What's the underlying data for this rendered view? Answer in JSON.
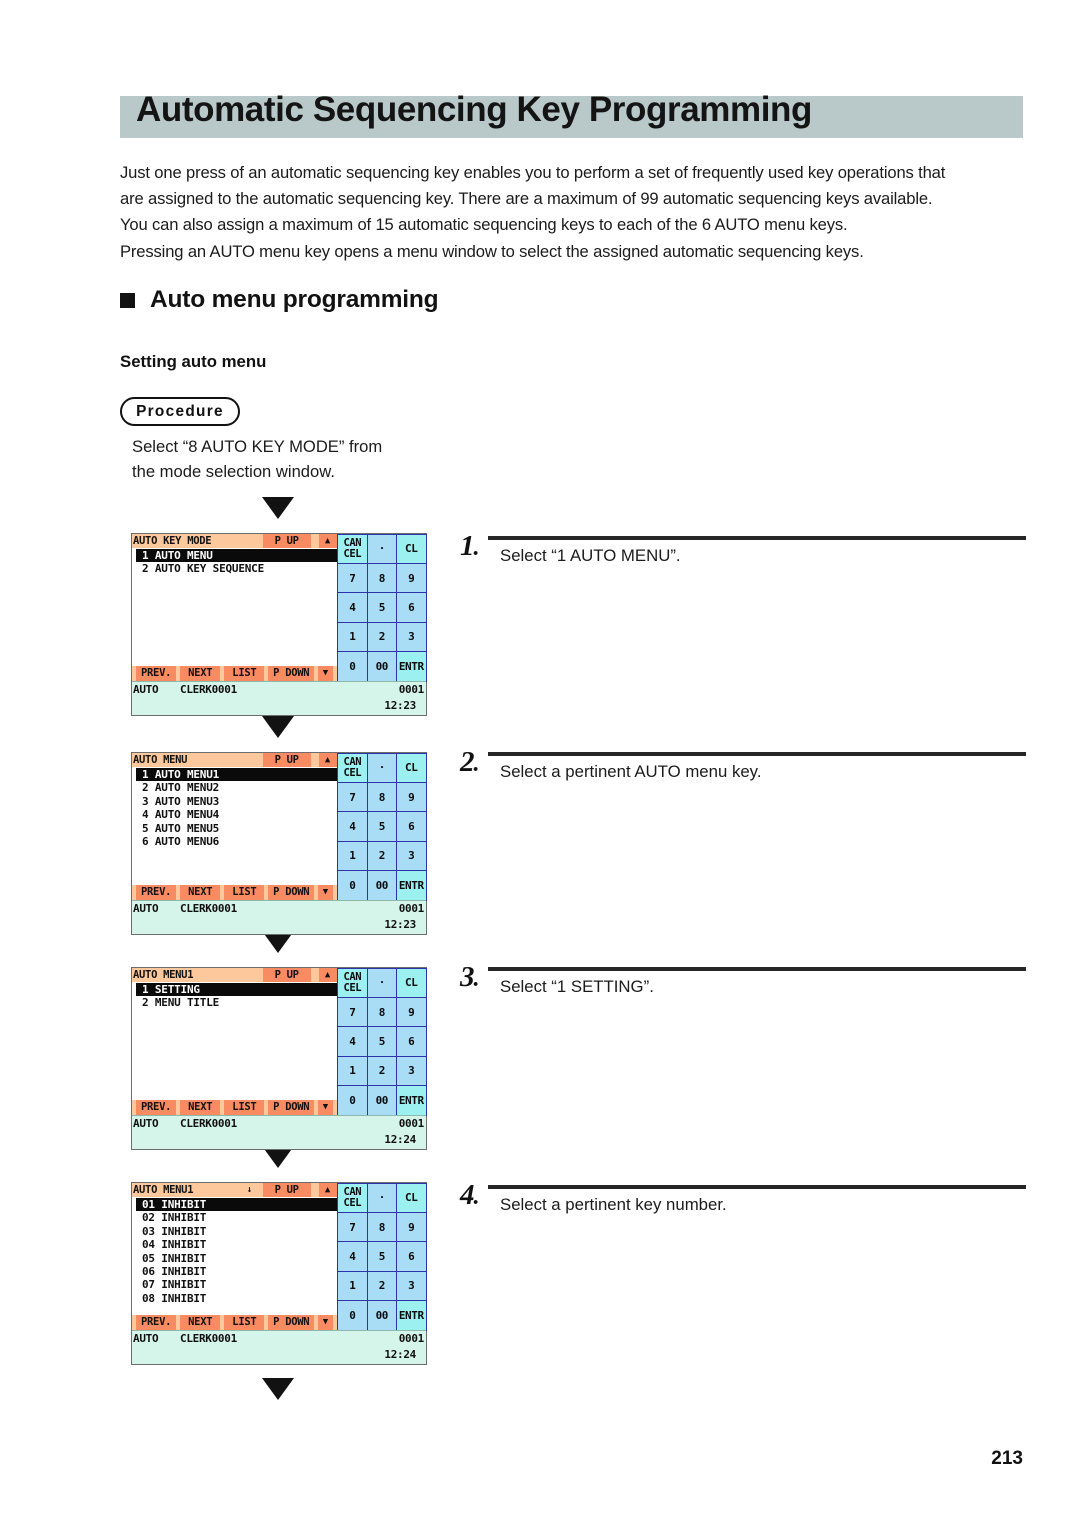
{
  "page": {
    "title": "Automatic Sequencing Key Programming",
    "page_number": "213",
    "banner_color": "#b9c8c9"
  },
  "intro": {
    "line1": "Just one press of an automatic sequencing key enables you to perform a set of frequently used key operations that",
    "line2": "are assigned to the automatic sequencing key. There are a maximum of 99 automatic sequencing keys available.",
    "line3": "You can also assign a maximum of 15 automatic sequencing keys to each of the 6 AUTO menu keys.",
    "line4": "Pressing an AUTO menu key opens a menu window to select the assigned automatic sequencing keys."
  },
  "section": {
    "heading": "Auto menu programming",
    "subheading": "Setting auto menu",
    "procedure_label": "Procedure",
    "procedure_intro_line1": "Select “8 AUTO KEY MODE” from",
    "procedure_intro_line2": "the mode selection window."
  },
  "steps": [
    {
      "number": "1",
      "dot": ".",
      "text": "Select “1 AUTO MENU”."
    },
    {
      "number": "2",
      "dot": ".",
      "text": "Select a pertinent AUTO menu key."
    },
    {
      "number": "3",
      "dot": ".",
      "text": "Select “1 SETTING”."
    },
    {
      "number": "4",
      "dot": ".",
      "text": "Select a pertinent key number."
    }
  ],
  "keypad": {
    "cancel_line1": "CAN",
    "cancel_line2": "CEL",
    "dot": "·",
    "cl": "CL",
    "k7": "7",
    "k8": "8",
    "k9": "9",
    "k4": "4",
    "k5": "5",
    "k6": "6",
    "k1": "1",
    "k2": "2",
    "k3": "3",
    "k0": "0",
    "k00": "00",
    "entr": "ENTR",
    "key_fill": "#a9dcf5",
    "key_accent": "#9cf0ef",
    "key_border": "#2b35a8"
  },
  "softkeys": {
    "prev": "PREV.",
    "next": "NEXT",
    "list": "LIST",
    "pdown": "P DOWN",
    "down_arrow": "▼",
    "bar_color": "#fcc89c",
    "key_color": "#f98b63"
  },
  "titlebar_common": {
    "pup": "P UP",
    "up_arrow": "▲",
    "down_indicator": "↓"
  },
  "screens": [
    {
      "id": "screen-auto-key-mode",
      "title": "AUTO KEY MODE",
      "show_down_indicator": false,
      "rows": [
        {
          "label": "1 AUTO MENU",
          "selected": true
        },
        {
          "label": "2 AUTO KEY SEQUENCE",
          "selected": false
        }
      ],
      "status": {
        "mode": "AUTO",
        "clerk": "CLERK0001",
        "number": "0001",
        "time": "12:23"
      }
    },
    {
      "id": "screen-auto-menu",
      "title": "AUTO MENU",
      "show_down_indicator": false,
      "rows": [
        {
          "label": "1 AUTO MENU1",
          "selected": true
        },
        {
          "label": "2 AUTO MENU2",
          "selected": false
        },
        {
          "label": "3 AUTO MENU3",
          "selected": false
        },
        {
          "label": "4 AUTO MENU4",
          "selected": false
        },
        {
          "label": "5 AUTO MENU5",
          "selected": false
        },
        {
          "label": "6 AUTO MENU6",
          "selected": false
        }
      ],
      "status": {
        "mode": "AUTO",
        "clerk": "CLERK0001",
        "number": "0001",
        "time": "12:23"
      }
    },
    {
      "id": "screen-auto-menu1",
      "title": "AUTO MENU1",
      "show_down_indicator": false,
      "rows": [
        {
          "label": "1 SETTING",
          "selected": true
        },
        {
          "label": "2 MENU TITLE",
          "selected": false
        }
      ],
      "status": {
        "mode": "AUTO",
        "clerk": "CLERK0001",
        "number": "0001",
        "time": "12:24"
      }
    },
    {
      "id": "screen-auto-menu1-keys",
      "title": "AUTO MENU1",
      "show_down_indicator": true,
      "rows": [
        {
          "label": "01 INHIBIT",
          "selected": true
        },
        {
          "label": "02 INHIBIT",
          "selected": false
        },
        {
          "label": "03 INHIBIT",
          "selected": false
        },
        {
          "label": "04 INHIBIT",
          "selected": false
        },
        {
          "label": "05 INHIBIT",
          "selected": false
        },
        {
          "label": "06 INHIBIT",
          "selected": false
        },
        {
          "label": "07 INHIBIT",
          "selected": false
        },
        {
          "label": "08 INHIBIT",
          "selected": false
        }
      ],
      "status": {
        "mode": "AUTO",
        "clerk": "CLERK0001",
        "number": "0001",
        "time": "12:24"
      }
    }
  ]
}
